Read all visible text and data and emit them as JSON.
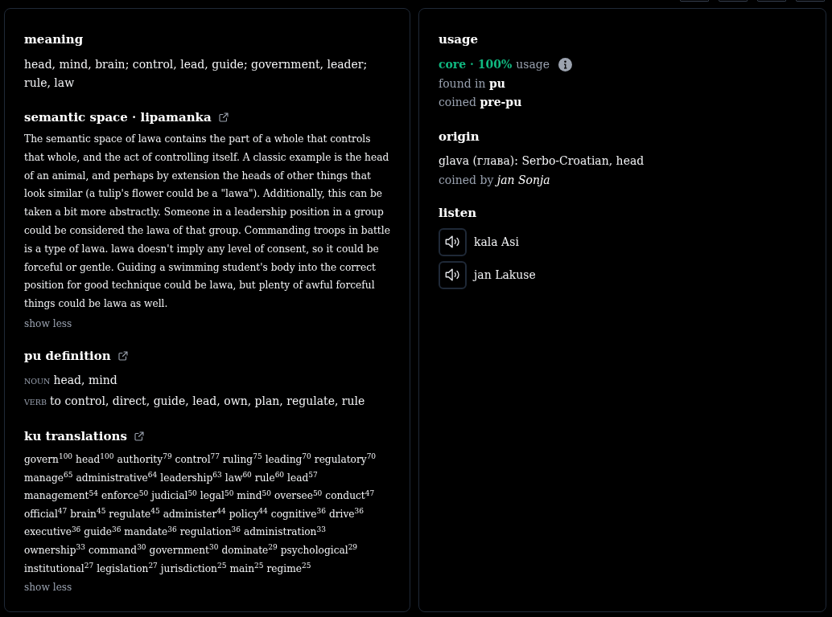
{
  "definition_panel": {
    "meaning": {
      "heading": "meaning",
      "text": "head, mind, brain; control, lead, guide; government, leader; rule, law"
    },
    "semantic_space": {
      "heading": "semantic space · lipamanka",
      "text": "The semantic space of lawa contains the part of a whole that controls that whole, and the act of controlling itself. A classic example is the head of an animal, and perhaps by extension the heads of other things that look similar (a tulip's flower could be a \"lawa\"). Additionally, this can be taken a bit more abstractly. Someone in a leadership position in a group could be considered the lawa of that group. Commanding troops in battle is a type of lawa. lawa doesn't imply any level of consent, so it could be forceful or gentle. Guiding a swimming student's body into the correct position for good technique could be lawa, but plenty of awful forceful things could be lawa as well.",
      "toggle": "show less"
    },
    "pu_definition": {
      "heading": "pu definition",
      "entries": [
        {
          "pos": "NOUN",
          "text": "head, mind"
        },
        {
          "pos": "VERB",
          "text": "to control, direct, guide, lead, own, plan, regulate, rule"
        }
      ]
    },
    "ku_translations": {
      "heading": "ku translations",
      "items": [
        "govern$^{100}$",
        "head$^{100}$",
        "authority$^{79}$",
        "control$^{77}$",
        "ruling$^{75}$",
        "leading$^{70}$",
        "regulatory$^{70}$",
        "manage$^{65}$",
        "administrative$^{64}$",
        "leadership$^{63}$",
        "law$^{60}$",
        "rule$^{60}$",
        "lead$^{57}$",
        "management$^{54}$",
        "enforce$^{50}$",
        "judicial$^{50}$",
        "legal$^{50}$",
        "mind$^{50}$",
        "oversee$^{50}$",
        "conduct$^{47}$",
        "official$^{47}$",
        "brain$^{45}$",
        "regulate$^{45}$",
        "administer$^{44}$",
        "policy$^{44}$",
        "cognitive$^{36}$",
        "drive$^{36}$",
        "executive$^{36}$",
        "guide$^{36}$",
        "mandate$^{36}$",
        "regulation$^{36}$",
        "administration$^{33}$",
        "ownership$^{33}$",
        "command$^{30}$",
        "government$^{30}$",
        "dominate$^{29}$",
        "psychological$^{29}$",
        "institutional$^{27}$",
        "legislation$^{27}$",
        "jurisdiction$^{25}$",
        "main$^{25}$",
        "regime$^{25}$"
      ],
      "toggle": "show less"
    }
  },
  "usage_panel": {
    "usage": {
      "heading": "usage",
      "tier": "core · 100%",
      "label": "usage",
      "details": [
        "found in **pu**",
        "coined **pre-pu**"
      ]
    },
    "origin": {
      "heading": "origin",
      "text": "glava (глава): Serbo-Croatian, head",
      "credit": "coined by *jan Sonja*"
    },
    "listen": {
      "heading": "listen",
      "speakers": [
        "kala Asi",
        "jan Lakuse"
      ]
    }
  }
}
